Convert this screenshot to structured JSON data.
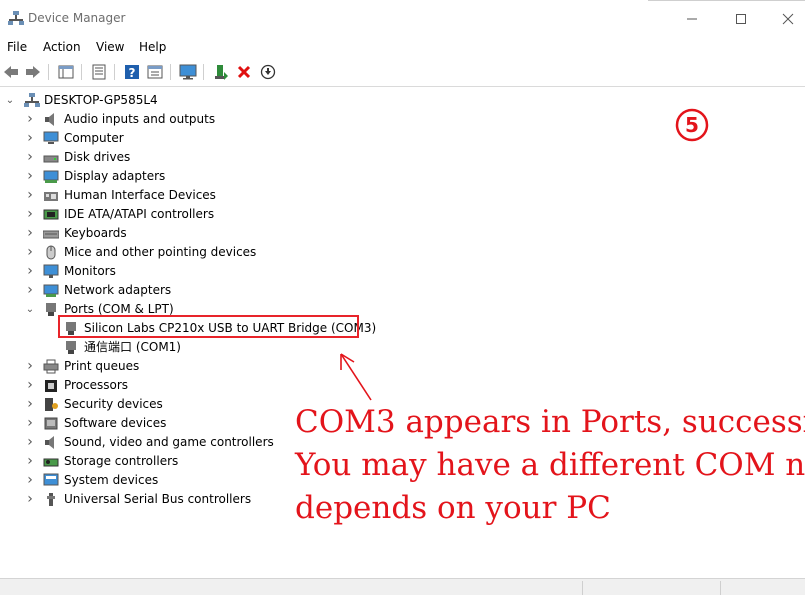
{
  "window": {
    "title": "Device Manager"
  },
  "menu": [
    "File",
    "Action",
    "View",
    "Help"
  ],
  "tree": {
    "root": "DESKTOP-GP585L4",
    "categories": [
      {
        "label": "Audio inputs and outputs",
        "icon": "speaker-icon",
        "expanded": false
      },
      {
        "label": "Computer",
        "icon": "computer-icon",
        "expanded": false
      },
      {
        "label": "Disk drives",
        "icon": "disk-drive-icon",
        "expanded": false
      },
      {
        "label": "Display adapters",
        "icon": "display-adapter-icon",
        "expanded": false
      },
      {
        "label": "Human Interface Devices",
        "icon": "hid-icon",
        "expanded": false
      },
      {
        "label": "IDE ATA/ATAPI controllers",
        "icon": "ide-controller-icon",
        "expanded": false
      },
      {
        "label": "Keyboards",
        "icon": "keyboard-icon",
        "expanded": false
      },
      {
        "label": "Mice and other pointing devices",
        "icon": "mouse-icon",
        "expanded": false
      },
      {
        "label": "Monitors",
        "icon": "monitor-icon",
        "expanded": false
      },
      {
        "label": "Network adapters",
        "icon": "network-adapter-icon",
        "expanded": false
      },
      {
        "label": "Ports (COM & LPT)",
        "icon": "port-icon",
        "expanded": true,
        "children": [
          "Silicon Labs CP210x USB to UART Bridge (COM3)",
          "通信端口 (COM1)"
        ]
      },
      {
        "label": "Print queues",
        "icon": "printer-icon",
        "expanded": false
      },
      {
        "label": "Processors",
        "icon": "processor-icon",
        "expanded": false
      },
      {
        "label": "Security devices",
        "icon": "security-device-icon",
        "expanded": false
      },
      {
        "label": "Software devices",
        "icon": "software-device-icon",
        "expanded": false
      },
      {
        "label": "Sound, video and game controllers",
        "icon": "sound-controller-icon",
        "expanded": false
      },
      {
        "label": "Storage controllers",
        "icon": "storage-controller-icon",
        "expanded": false
      },
      {
        "label": "System devices",
        "icon": "system-device-icon",
        "expanded": false
      },
      {
        "label": "Universal Serial Bus controllers",
        "icon": "usb-icon",
        "expanded": false
      }
    ]
  },
  "annotation": {
    "step": "5",
    "lines": [
      "COM3 appears in Ports, successf",
      "You may have a different COM nu",
      "depends on your PC"
    ]
  },
  "colors": {
    "annotation": "#e3141b",
    "highlight_box": "#e8242a"
  }
}
